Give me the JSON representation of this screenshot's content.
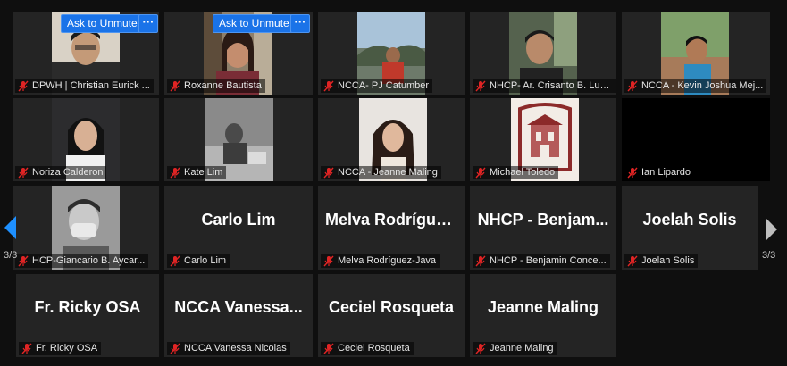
{
  "actions": {
    "unmute_label": "Ask to Unmute",
    "more_label": "···"
  },
  "pager": {
    "left_indicator": "3/3",
    "right_indicator": "3/3"
  },
  "participants": [
    {
      "name": "DPWH | Christian Eurick ...",
      "video": true
    },
    {
      "name": "Roxanne Bautista",
      "video": true
    },
    {
      "name": "NCCA- PJ Catumber",
      "video": true
    },
    {
      "name": "NHCP- Ar. Crisanto B. Lust...",
      "video": true
    },
    {
      "name": "NCCA - Kevin Joshua Mej...",
      "video": true
    },
    {
      "name": "Noriza Calderon",
      "video": true
    },
    {
      "name": "Kate Lim",
      "video": true
    },
    {
      "name": "NCCA - Jeanne Maling",
      "video": true
    },
    {
      "name": "Michael Toledo",
      "video": true
    },
    {
      "name": "Ian Lipardo",
      "video": false
    },
    {
      "name": "HCP-Giancario B. Aycar...",
      "video": true
    },
    {
      "name": "Carlo Lim",
      "display": "Carlo Lim",
      "video": false
    },
    {
      "name": "Melva Rodríguez-Java",
      "display": "Melva  Rodrígue...",
      "video": false
    },
    {
      "name": "NHCP - Benjamin Conce...",
      "display": "NHCP  -  Benjam...",
      "video": false
    },
    {
      "name": "Joelah Solis",
      "display": "Joelah Solis",
      "video": false
    },
    {
      "name": "Fr. Ricky OSA",
      "display": "Fr. Ricky OSA",
      "video": false
    },
    {
      "name": "NCCA Vanessa Nicolas",
      "display": "NCCA  Vanessa...",
      "video": false
    },
    {
      "name": "Ceciel Rosqueta",
      "display": "Ceciel Rosqueta",
      "video": false
    },
    {
      "name": "Jeanne Maling",
      "display": "Jeanne Maling",
      "video": false
    }
  ],
  "colors": {
    "tile_bg": "#242424",
    "accent_blue": "#1a73e8",
    "mic_muted_red": "#e02424"
  }
}
